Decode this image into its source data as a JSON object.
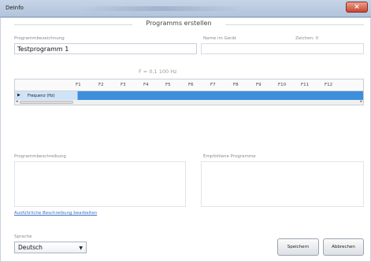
{
  "window": {
    "title": "DeInfo",
    "close_label": "×"
  },
  "header": {
    "title": "Programms erstellen"
  },
  "fields": {
    "program_name_label": "Programmbezeichnung",
    "program_name_value": "Testprogramm 1",
    "device_name_label": "Name im Gerät",
    "chars_label": "Zeichen: 0"
  },
  "freq_info": "F = 0,1   100 Hz",
  "grid": {
    "columns": [
      "F1",
      "F2",
      "F3",
      "F4",
      "F5",
      "F6",
      "F7",
      "F8",
      "F9",
      "F10",
      "F11",
      "F12"
    ],
    "rows": [
      {
        "marker": "▶",
        "label": "Frequenz (Hz)",
        "selected": true
      }
    ]
  },
  "description": {
    "label": "Programmbeschreibung"
  },
  "recommended": {
    "label": "Empfohlene Programme"
  },
  "detail_link": "Ausführliche Beschreibung bearbeiten",
  "language": {
    "label": "Sprache",
    "value": "Deutsch"
  },
  "buttons": {
    "save": "Speichern",
    "cancel": "Abbrechen"
  },
  "colors": {
    "selection": "#3d8fdc",
    "row_header": "#cfe3f8",
    "link": "#3a6fc4",
    "close": "#c9452f"
  }
}
